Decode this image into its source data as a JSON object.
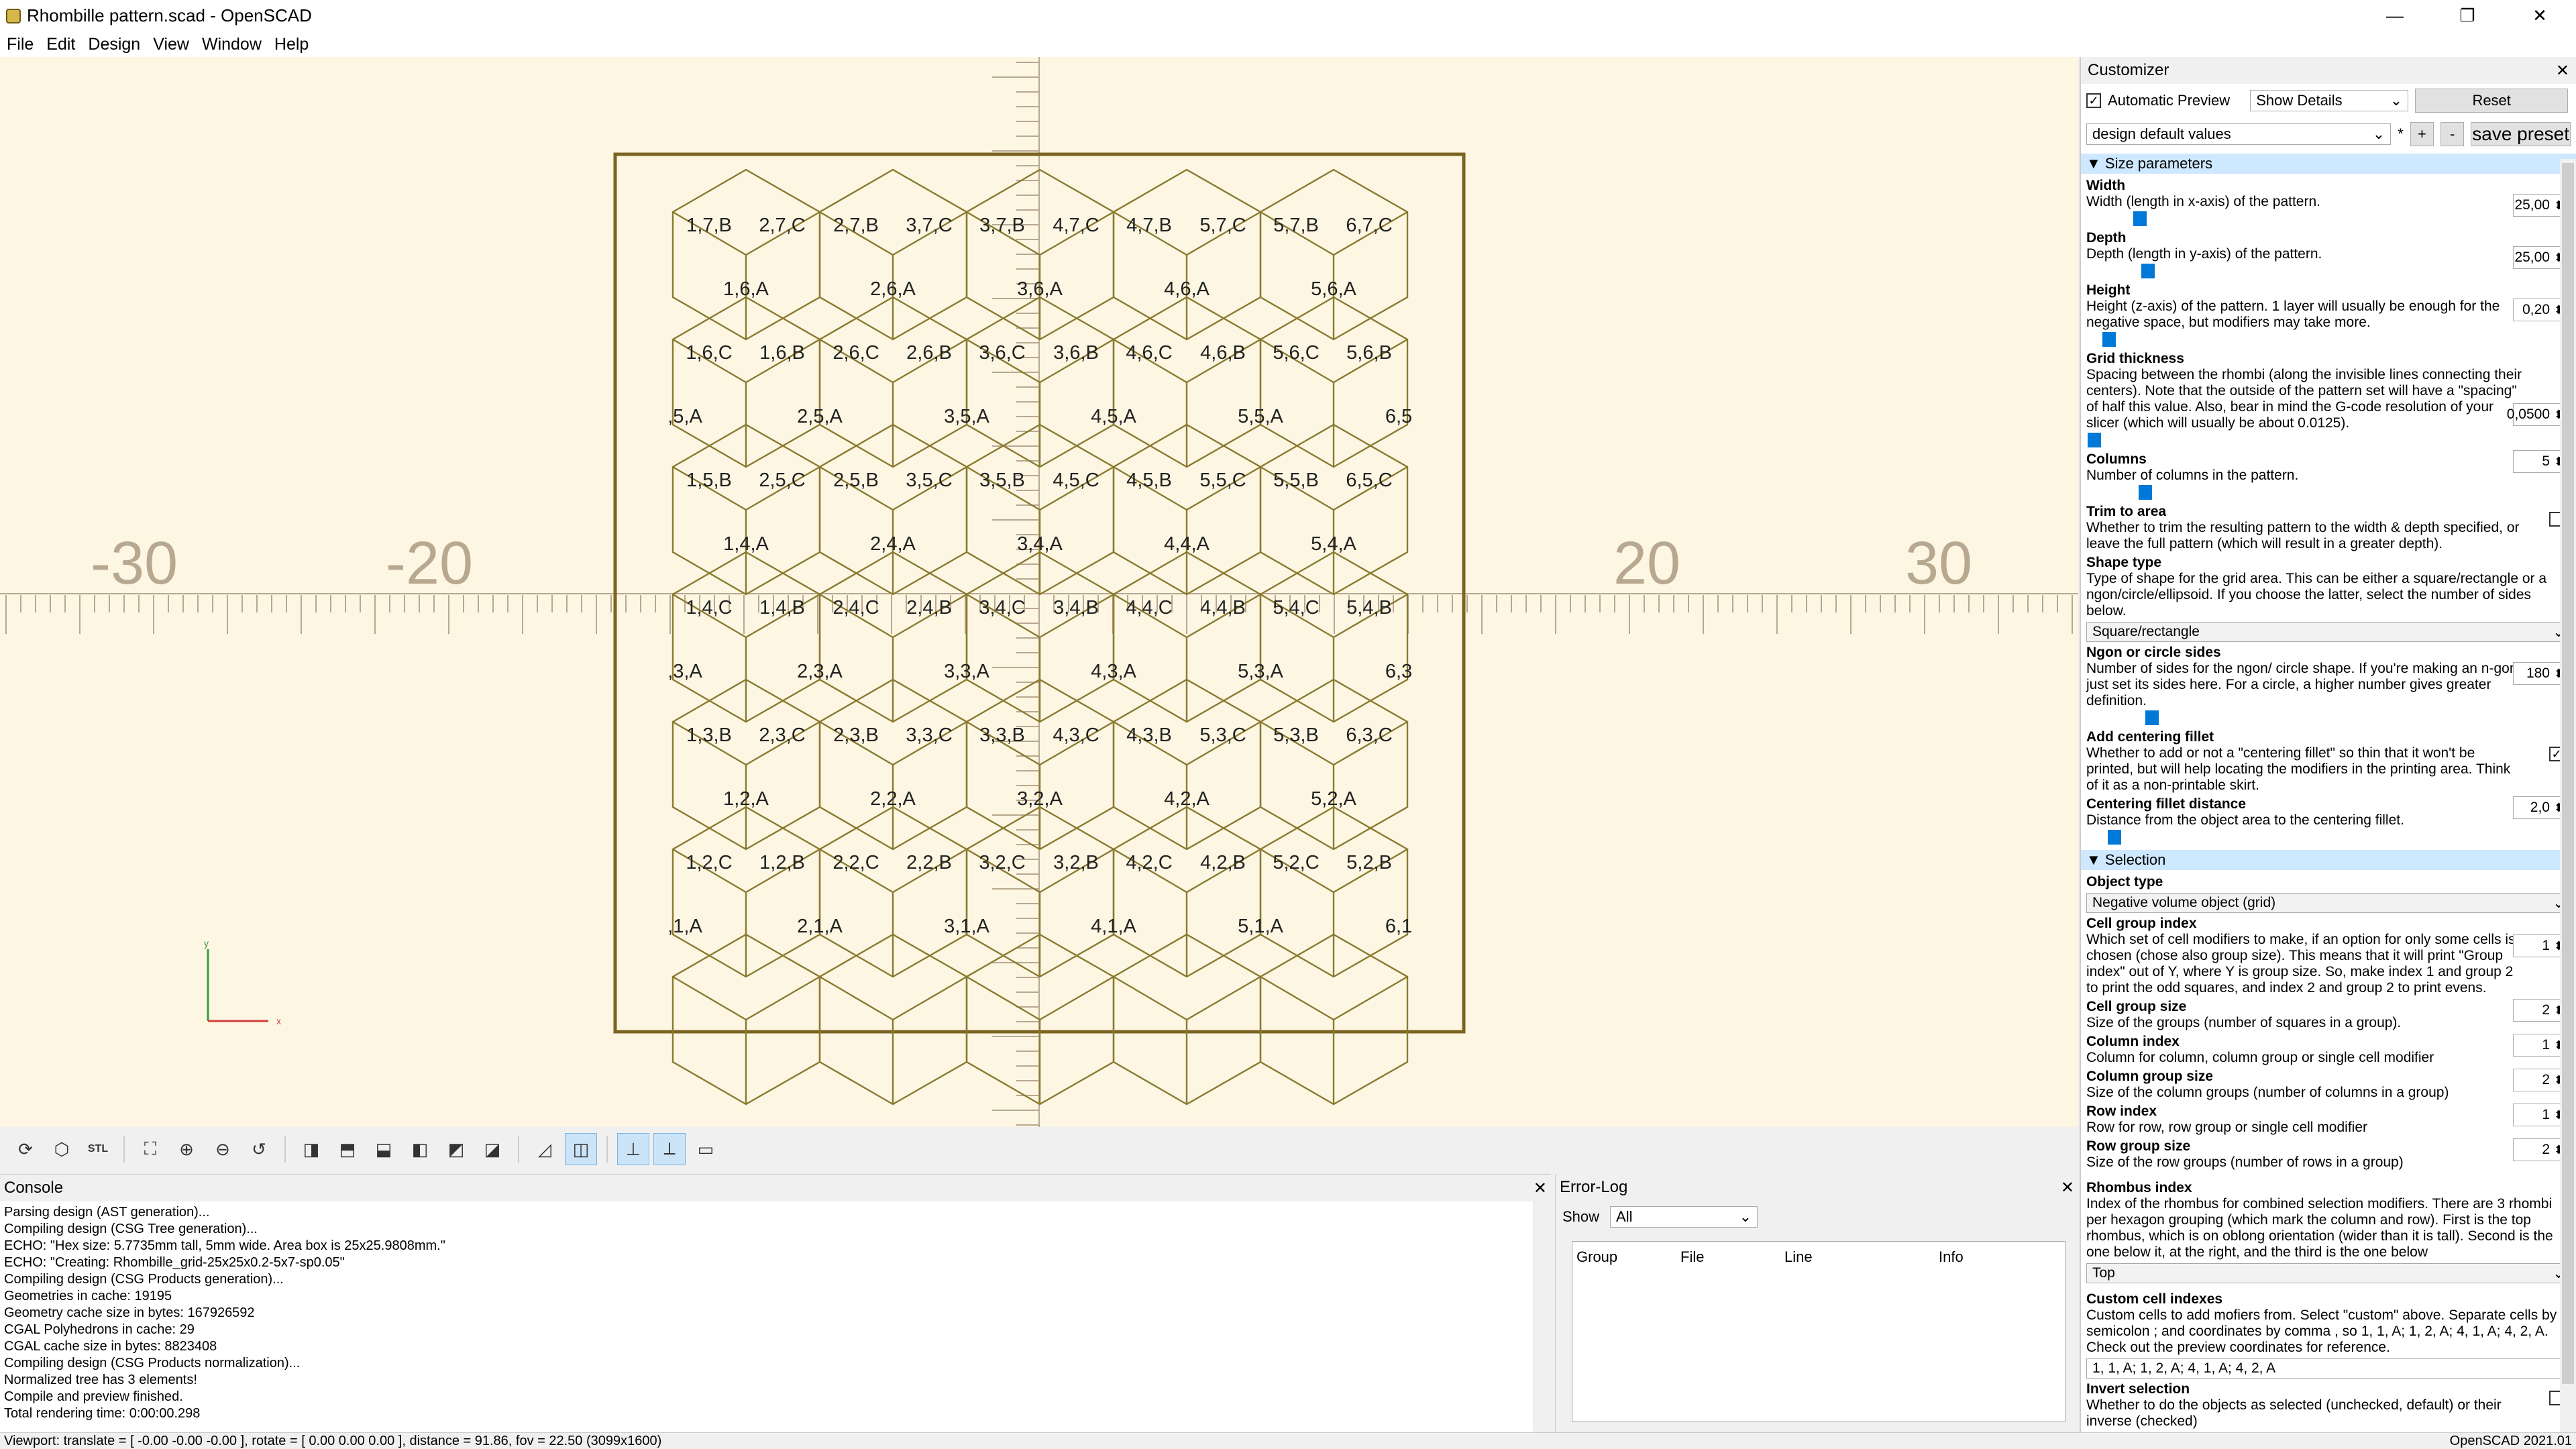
{
  "window": {
    "title": "Rhombille pattern.scad - OpenSCAD",
    "min": "—",
    "max": "❐",
    "close": "✕"
  },
  "menu": [
    "File",
    "Edit",
    "Design",
    "View",
    "Window",
    "Help"
  ],
  "axes": {
    "x_neg": [
      "-30",
      "-20"
    ],
    "x_pos": [
      "20",
      "30"
    ]
  },
  "grid_labels": [
    "1,7,B",
    "2,7,C",
    "2,7,B",
    "3,7,C",
    "3,7,B",
    "4,7,C",
    "4,7,B",
    "5,7,C",
    "5,7,B",
    "6,7,C",
    "1,6,A",
    "2,6,A",
    "3,6,A",
    "4,6,A",
    "5,6,A",
    "1,6,C",
    "1,6,B",
    "2,6,C",
    "2,6,B",
    "3,6,C",
    "3,6,B",
    "4,6,C",
    "4,6,B",
    "5,6,C",
    "5,6,B",
    ",5,A",
    "2,5,A",
    "3,5,A",
    "4,5,A",
    "5,5,A",
    "6,5",
    "1,5,B",
    "2,5,C",
    "2,5,B",
    "3,5,C",
    "3,5,B",
    "4,5,C",
    "4,5,B",
    "5,5,C",
    "5,5,B",
    "6,5,C",
    "1,4,A",
    "2,4,A",
    "3,4,A",
    "4,4,A",
    "5,4,A",
    "1,4,C",
    "1,4,B",
    "2,4,C",
    "2,4,B",
    "3,4,C",
    "3,4,B",
    "4,4,C",
    "4,4,B",
    "5,4,C",
    "5,4,B",
    ",3,A",
    "2,3,A",
    "3,3,A",
    "4,3,A",
    "5,3,A",
    "6,3",
    "1,3,B",
    "2,3,C",
    "2,3,B",
    "3,3,C",
    "3,3,B",
    "4,3,C",
    "4,3,B",
    "5,3,C",
    "5,3,B",
    "6,3,C",
    "1,2,A",
    "2,2,A",
    "3,2,A",
    "4,2,A",
    "5,2,A",
    "1,2,C",
    "1,2,B",
    "2,2,C",
    "2,2,B",
    "3,2,C",
    "3,2,B",
    "4,2,C",
    "4,2,B",
    "5,2,C",
    "5,2,B",
    ",1,A",
    "2,1,A",
    "3,1,A",
    "4,1,A",
    "5,1,A",
    "6,1"
  ],
  "gizmo": {
    "x": "x",
    "y": "y"
  },
  "console": {
    "title": "Console",
    "lines": [
      "Parsing design (AST generation)...",
      "Compiling design (CSG Tree generation)...",
      "ECHO: \"Hex size: 5.7735mm tall, 5mm wide. Area box is 25x25.9808mm.\"",
      "ECHO: \"Creating: Rhombille_grid-25x25x0.2-5x7-sp0.05\"",
      "Compiling design (CSG Products generation)...",
      "Geometries in cache: 19195",
      "Geometry cache size in bytes: 167926592",
      "CGAL Polyhedrons in cache: 29",
      "CGAL cache size in bytes: 8823408",
      "Compiling design (CSG Products normalization)...",
      "Normalized tree has 3 elements!",
      "Compile and preview finished.",
      "Total rendering time: 0:00:00.298"
    ]
  },
  "errorlog": {
    "title": "Error-Log",
    "show_label": "Show",
    "show_value": "All",
    "cols": [
      "Group",
      "File",
      "Line",
      "Info"
    ]
  },
  "status": {
    "left": "Viewport: translate = [ -0.00 -0.00 -0.00 ], rotate = [ 0.00 0.00 0.00 ], distance = 91.86, fov = 22.50 (3099x1600)",
    "right": "OpenSCAD 2021.01"
  },
  "customizer": {
    "title": "Customizer",
    "auto_preview": "Automatic Preview",
    "details": "Show Details",
    "reset": "Reset",
    "preset": "design default values",
    "preset_mark": "*",
    "plus": "+",
    "minus": "-",
    "save_preset": "save preset",
    "sec_size": "Size parameters",
    "p_width_name": "Width",
    "p_width_desc": "Width (length in x-axis) of the pattern.",
    "p_width_val": "25,00",
    "p_depth_name": "Depth",
    "p_depth_desc": "Depth (length in y-axis) of the pattern.",
    "p_depth_val": "25,00",
    "p_height_name": "Height",
    "p_height_desc": "Height (z-axis) of the pattern. 1 layer will usually be enough for the negative space, but modifiers may take more.",
    "p_height_val": "0,20",
    "p_grid_name": "Grid thickness",
    "p_grid_desc": "Spacing between the rhombi (along the invisible lines connecting their centers). Note that the outside of the pattern set will have a \"spacing\" of half this value. Also, bear in mind the G-code resolution of your slicer (which will usually be about 0.0125).",
    "p_grid_val": "0,0500",
    "p_cols_name": "Columns",
    "p_cols_desc": "Number of columns in the pattern.",
    "p_cols_val": "5",
    "p_trim_name": "Trim to area",
    "p_trim_desc": "Whether to trim the resulting pattern to the width & depth specified, or leave the full pattern (which will result in a greater depth).",
    "p_shape_name": "Shape type",
    "p_shape_desc": "Type of shape for the grid area. This can be either a square/rectangle or a ngon/circle/ellipsoid. If you choose the latter, select the number of sides below.",
    "p_shape_val": "Square/rectangle",
    "p_ngon_name": "Ngon or circle sides",
    "p_ngon_desc": "Number of sides for the ngon/ circle shape. If you're making an n-gon, just set its sides here. For a circle, a higher number gives greater definition.",
    "p_ngon_val": "180",
    "p_fillet_name": "Add centering fillet",
    "p_fillet_desc": "Whether to add or not a \"centering fillet\" so thin that it won't be printed, but will help locating the modifiers in the printing area. Think of it as a non-printable skirt.",
    "p_fillet_check": "✓",
    "p_filletd_name": "Centering fillet distance",
    "p_filletd_desc": "Distance from the object area to the centering fillet.",
    "p_filletd_val": "2,0",
    "sec_sel": "Selection",
    "p_obj_name": "Object type",
    "p_obj_val": "Negative volume object (grid)",
    "p_cgi_name": "Cell group index",
    "p_cgi_desc": "Which set of cell modifiers to make, if an option for only some cells is chosen (chose also group size). This means that it will print \"Group index\" out of Y, where Y is group size. So, make index 1 and group 2 to print the odd squares, and index 2 and group 2 to print evens.",
    "p_cgi_val": "1",
    "p_cgs_name": "Cell group size",
    "p_cgs_desc": "Size of the groups (number of squares in a group).",
    "p_cgs_val": "2",
    "p_ci_name": "Column index",
    "p_ci_desc": "Column for column, column group or single cell modifier",
    "p_ci_val": "1",
    "p_cs_name": "Column group size",
    "p_cs_desc": "Size of the column groups (number of columns in a group)",
    "p_cs_val": "2",
    "p_ri_name": "Row index",
    "p_ri_desc": "Row for row, row group or single cell modifier",
    "p_ri_val": "1",
    "p_rs_name": "Row group size",
    "p_rs_desc": "Size of the row groups (number of rows in a group)",
    "p_rs_val": "2",
    "p_rh_name": "Rhombus index",
    "p_rh_desc": "Index of the rhombus for combined selection modifiers. There are 3 rhombi per hexagon grouping (which mark the column and row). First is the top rhombus, which is on oblong orientation (wider than it is tall). Second is the one below it, at the right, and the third is the one below",
    "p_rh_val": "Top",
    "p_cc_name": "Custom cell indexes",
    "p_cc_desc": "Custom cells to add mofiers from. Select \"custom\" above. Separate cells by semicolon ; and coordinates by comma , so 1, 1, A; 1, 2, A; 4, 1, A; 4, 2, A. Check out the preview coordinates for reference.",
    "p_cc_val": "1, 1, A; 1, 2, A; 4, 1, A; 4, 2, A",
    "p_inv_name": "Invert selection",
    "p_inv_desc": "Whether to do the objects as selected (unchecked, default) or their inverse (checked)"
  }
}
